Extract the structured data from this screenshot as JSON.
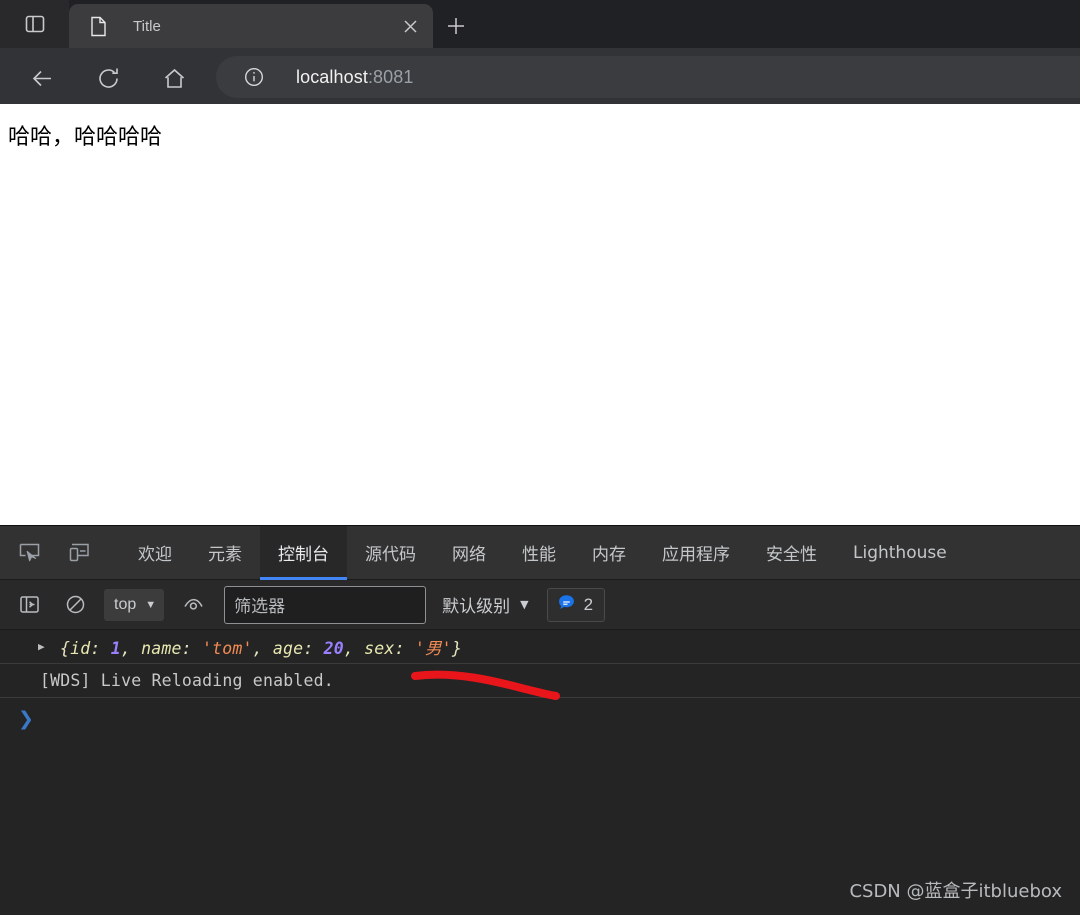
{
  "browser": {
    "tab_search_icon": "sidebar-panel-icon",
    "tab": {
      "favicon": "document-icon",
      "title": "Title",
      "close_icon": "close-icon"
    },
    "new_tab_label": "+",
    "nav": {
      "back_icon": "arrow-left-icon",
      "reload_icon": "reload-icon",
      "home_icon": "home-icon"
    },
    "omnibox": {
      "info_icon": "info-circle-icon",
      "host": "localhost",
      "port": ":8081"
    }
  },
  "page": {
    "text": "哈哈，哈哈哈哈"
  },
  "devtools": {
    "inspect_icon": "inspect-element-icon",
    "device_icon": "device-toolbar-icon",
    "tabs": [
      {
        "label": "欢迎",
        "active": false
      },
      {
        "label": "元素",
        "active": false
      },
      {
        "label": "控制台",
        "active": true
      },
      {
        "label": "源代码",
        "active": false
      },
      {
        "label": "网络",
        "active": false
      },
      {
        "label": "性能",
        "active": false
      },
      {
        "label": "内存",
        "active": false
      },
      {
        "label": "应用程序",
        "active": false
      },
      {
        "label": "安全性",
        "active": false
      },
      {
        "label": "Lighthouse",
        "active": false
      }
    ],
    "console_toolbar": {
      "sidebar_icon": "console-sidebar-icon",
      "clear_icon": "clear-console-icon",
      "context": "top",
      "context_caret": "▼",
      "eye_icon": "live-expression-icon",
      "filter_placeholder": "筛选器",
      "level_label": "默认级别",
      "level_caret": "▼",
      "message_icon": "message-bubble-icon",
      "message_count": "2"
    },
    "console_rows": [
      {
        "type": "object",
        "expand_icon": "▶",
        "tokens": [
          {
            "t": "punct",
            "v": "{"
          },
          {
            "t": "key",
            "v": "id"
          },
          {
            "t": "punct",
            "v": ": "
          },
          {
            "t": "num",
            "v": "1"
          },
          {
            "t": "punct",
            "v": ", "
          },
          {
            "t": "key",
            "v": "name"
          },
          {
            "t": "punct",
            "v": ": "
          },
          {
            "t": "str",
            "v": "'tom'"
          },
          {
            "t": "punct",
            "v": ", "
          },
          {
            "t": "key",
            "v": "age"
          },
          {
            "t": "punct",
            "v": ": "
          },
          {
            "t": "num",
            "v": "20"
          },
          {
            "t": "punct",
            "v": ", "
          },
          {
            "t": "key",
            "v": "sex"
          },
          {
            "t": "punct",
            "v": ": "
          },
          {
            "t": "str",
            "v": "'男'"
          },
          {
            "t": "punct",
            "v": "}"
          }
        ],
        "plain": "{id: 1, name: 'tom', age: 20, sex: '男'}"
      },
      {
        "type": "message",
        "text": "[WDS] Live Reloading enabled."
      }
    ],
    "prompt_chevron": "❯"
  },
  "annotation": {
    "color": "#e8161a",
    "shape": "hand-drawn-underline"
  },
  "watermark": {
    "text": "CSDN @蓝盒子itbluebox"
  }
}
